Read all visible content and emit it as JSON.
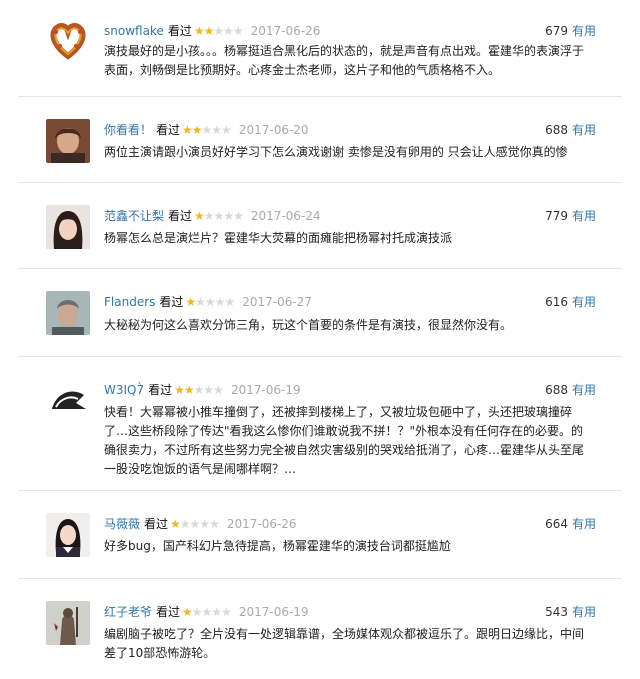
{
  "useful_label": "有用",
  "watched_label": "看过",
  "comments": [
    {
      "user": "snowflake",
      "stars": 2,
      "date": "2017-06-26",
      "votes": "679",
      "avatar_icon": "heart-wreath-avatar",
      "text": "演技最好的是小孩。。。杨幂挺适合黑化后的状态的，就是声音有点出戏。霍建华的表演浮于表面，刘畅倒是比预期好。心疼金士杰老师，这片子和他的气质格格不入。"
    },
    {
      "user": "你看看！",
      "stars": 2,
      "date": "2017-06-20",
      "votes": "688",
      "avatar_icon": "person-photo-avatar",
      "text": "两位主演请跟小演员好好学习下怎么演戏谢谢 卖惨是没有卵用的 只会让人感觉你真的惨"
    },
    {
      "user": "范鑫不让梨",
      "stars": 1,
      "date": "2017-06-24",
      "votes": "779",
      "avatar_icon": "girl-photo-avatar",
      "text": "杨幂怎么总是演烂片？霍建华大荧幕的面瘫能把杨幂衬托成演技派"
    },
    {
      "user": "Flanders",
      "stars": 1,
      "date": "2017-06-27",
      "votes": "616",
      "avatar_icon": "man-photo-avatar",
      "text": "大秘秘为何这么喜欢分饰三角，玩这个首要的条件是有演技，很显然你没有。"
    },
    {
      "user": "W3IQ7̀",
      "stars": 2,
      "date": "2017-06-19",
      "votes": "688",
      "avatar_icon": "bird-drawing-avatar",
      "text": "快看！大幂幂被小推车撞倒了，还被摔到楼梯上了，又被垃圾包砸中了，头还把玻璃撞碎了…这些桥段除了传达\"看我这么惨你们谁敢说我不拼！？\"外根本没有任何存在的必要。的确很卖力，不过所有这些努力完全被自然灾害级别的哭戏给抵消了，心疼…霍建华从头至尾一股没吃饱饭的语气是闹哪样啊？…"
    },
    {
      "user": "马薇薇",
      "stars": 1,
      "date": "2017-06-26",
      "votes": "664",
      "avatar_icon": "woman-photo-avatar",
      "text": "好多bug，国产科幻片急待提高，杨幂霍建华的演技台词都挺尴尬"
    },
    {
      "user": "红子老爷",
      "stars": 1,
      "date": "2017-06-19",
      "votes": "543",
      "avatar_icon": "knight-statue-avatar",
      "text": "编剧脑子被吃了？全片没有一处逻辑靠谱，全场媒体观众都被逗乐了。跟明日边缘比，中间差了10部恐怖游轮。"
    }
  ]
}
